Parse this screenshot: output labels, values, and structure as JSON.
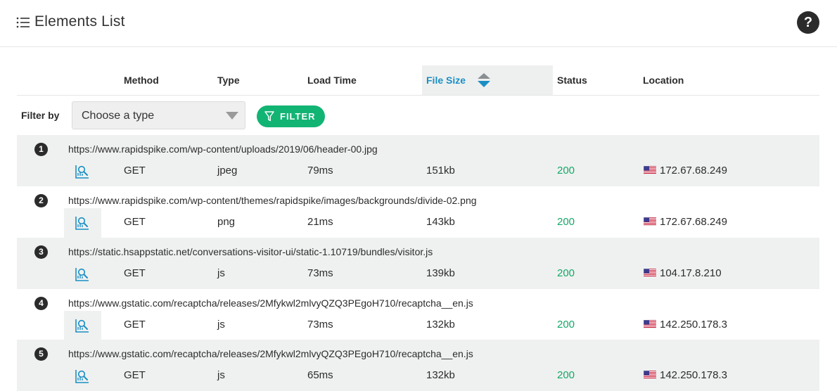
{
  "header": {
    "title": "Elements List",
    "help_label": "?"
  },
  "columns": {
    "method": "Method",
    "type": "Type",
    "load_time": "Load Time",
    "file_size": "File Size",
    "status": "Status",
    "location": "Location",
    "sorted_column": "file_size"
  },
  "filter": {
    "label": "Filter by",
    "select_value": "Choose a type",
    "button_label": "FILTER"
  },
  "colors": {
    "accent": "#1b8fc4",
    "filter_button": "#12b474",
    "status_ok": "#14a867"
  },
  "rows": [
    {
      "index": "1",
      "url": "https://www.rapidspike.com/wp-content/uploads/2019/06/header-00.jpg",
      "method": "GET",
      "type": "jpeg",
      "load_time": "79ms",
      "file_size": "151kb",
      "status": "200",
      "location": "172.67.68.249"
    },
    {
      "index": "2",
      "url": "https://www.rapidspike.com/wp-content/themes/rapidspike/images/backgrounds/divide-02.png",
      "method": "GET",
      "type": "png",
      "load_time": "21ms",
      "file_size": "143kb",
      "status": "200",
      "location": "172.67.68.249"
    },
    {
      "index": "3",
      "url": "https://static.hsappstatic.net/conversations-visitor-ui/static-1.10719/bundles/visitor.js",
      "method": "GET",
      "type": "js",
      "load_time": "73ms",
      "file_size": "139kb",
      "status": "200",
      "location": "104.17.8.210"
    },
    {
      "index": "4",
      "url": "https://www.gstatic.com/recaptcha/releases/2Mfykwl2mlvyQZQ3PEgoH710/recaptcha__en.js",
      "method": "GET",
      "type": "js",
      "load_time": "73ms",
      "file_size": "132kb",
      "status": "200",
      "location": "142.250.178.3"
    },
    {
      "index": "5",
      "url": "https://www.gstatic.com/recaptcha/releases/2Mfykwl2mlvyQZQ3PEgoH710/recaptcha__en.js",
      "method": "GET",
      "type": "js",
      "load_time": "65ms",
      "file_size": "132kb",
      "status": "200",
      "location": "142.250.178.3"
    }
  ]
}
